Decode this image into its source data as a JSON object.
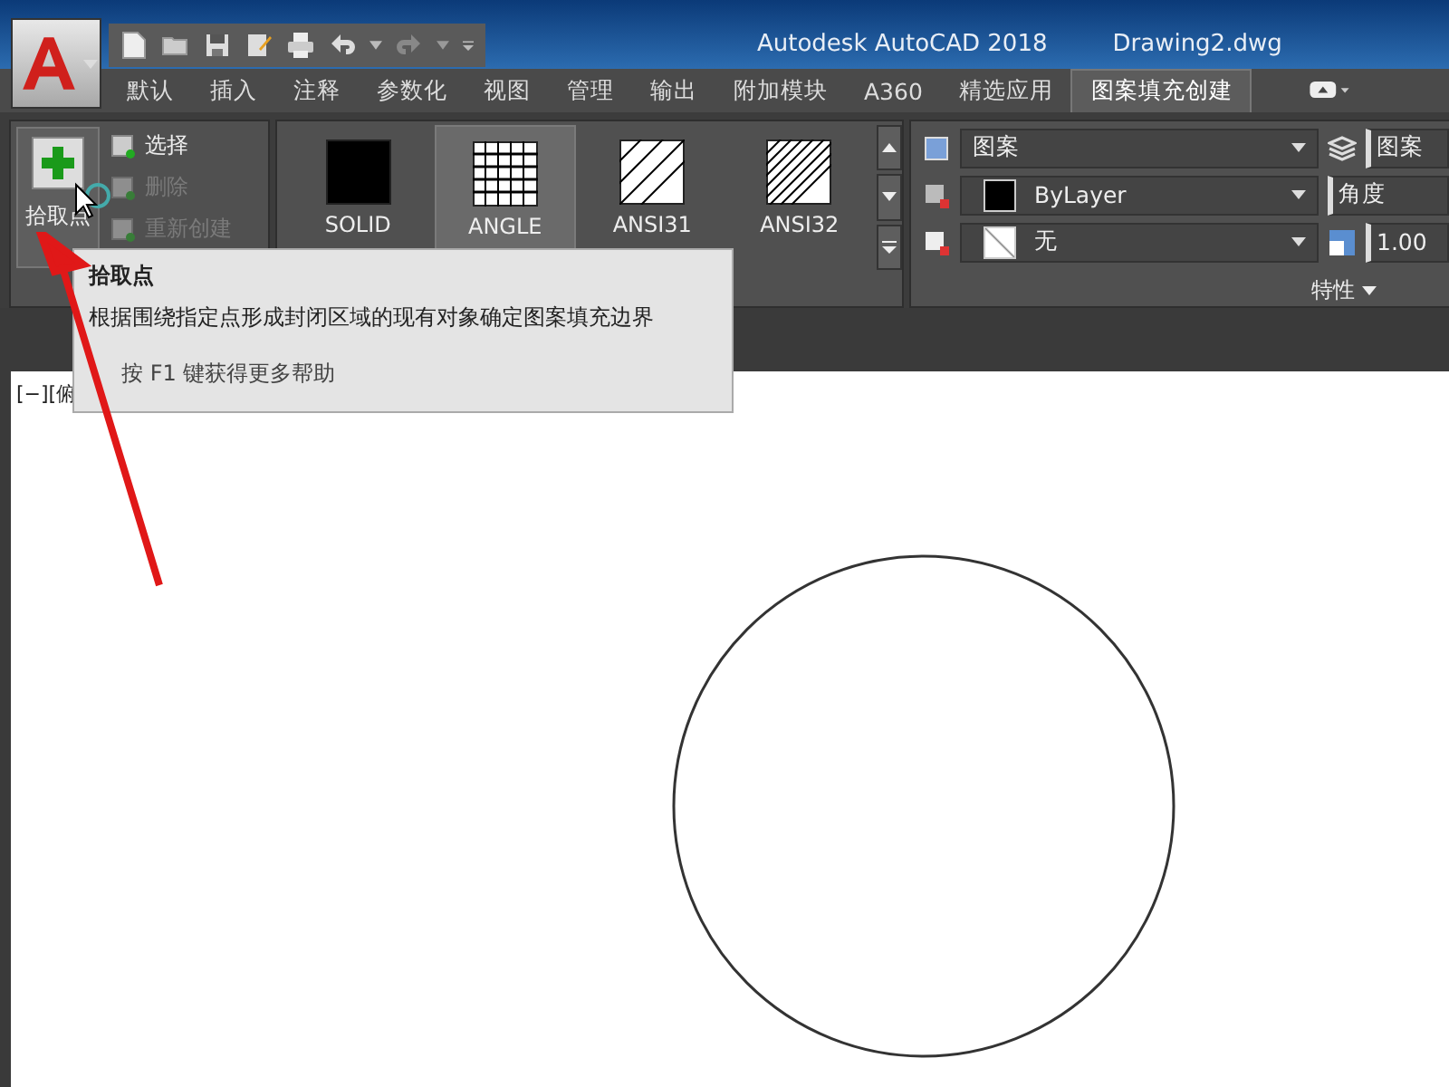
{
  "window": {
    "title": "Autodesk AutoCAD 2018",
    "document": "Drawing2.dwg"
  },
  "ribbon_tabs": [
    {
      "label": "默认",
      "selected": false
    },
    {
      "label": "插入",
      "selected": false
    },
    {
      "label": "注释",
      "selected": false
    },
    {
      "label": "参数化",
      "selected": false
    },
    {
      "label": "视图",
      "selected": false
    },
    {
      "label": "管理",
      "selected": false
    },
    {
      "label": "输出",
      "selected": false
    },
    {
      "label": "附加模块",
      "selected": false
    },
    {
      "label": "A360",
      "selected": false
    },
    {
      "label": "精选应用",
      "selected": false
    },
    {
      "label": "图案填充创建",
      "selected": true
    }
  ],
  "boundary_panel": {
    "pick_points": {
      "label": "拾取点"
    },
    "tools": [
      {
        "label": "选择",
        "disabled": false
      },
      {
        "label": "删除",
        "disabled": true
      },
      {
        "label": "重新创建",
        "disabled": true
      }
    ]
  },
  "pattern_panel": {
    "patterns": [
      {
        "name": "SOLID",
        "kind": "solid",
        "selected": false
      },
      {
        "name": "ANGLE",
        "kind": "grid",
        "selected": true
      },
      {
        "name": "ANSI31",
        "kind": "single-hatch",
        "selected": false
      },
      {
        "name": "ANSI32",
        "kind": "double-hatch",
        "selected": false
      }
    ]
  },
  "properties_panel": {
    "title": "特性",
    "hatch_type": "图案",
    "color_setting": "ByLayer",
    "background": "无",
    "transparency": "图案",
    "angle": "角度",
    "scale": "1.00"
  },
  "viewport_label": "[−][俯",
  "tooltip": {
    "title": "拾取点",
    "description": "根据围绕指定点形成封闭区域的现有对象确定图案填充边界",
    "help": "按 F1 键获得更多帮助"
  }
}
